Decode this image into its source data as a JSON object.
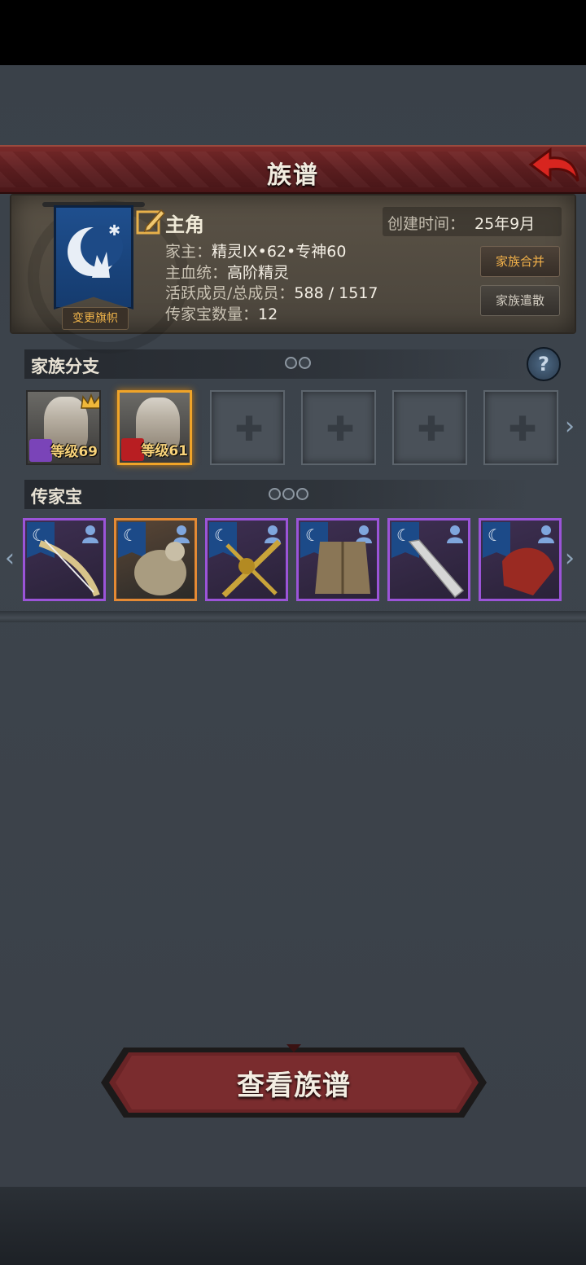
{
  "header": {
    "title": "族谱"
  },
  "profile": {
    "name": "主角",
    "created_label": "创建时间：",
    "created_value": "25年9月",
    "rows": [
      {
        "label": "家主：",
        "value": "精灵IX•62•专神60"
      },
      {
        "label": "主血统：",
        "value": "高阶精灵"
      },
      {
        "label": "活跃成员/总成员：",
        "value": "588 / 1517"
      },
      {
        "label": "传家宝数量：",
        "value": "12"
      }
    ],
    "change_banner_label": "变更旗帜",
    "merge_label": "家族合并",
    "disband_label": "家族遣散"
  },
  "branches": {
    "title": "家族分支",
    "heroes": [
      {
        "level": "等级69"
      },
      {
        "level": "等级61"
      }
    ]
  },
  "heirlooms": {
    "title": "传家宝"
  },
  "actions": {
    "view_label": "查看族谱"
  },
  "colors": {
    "accent_gold": "#f0a428",
    "purple_rarity": "#9b54d8",
    "orange_rarity": "#e48a34",
    "header_red": "#6a2224"
  },
  "icons": [
    "back-arrow-icon",
    "edit-icon",
    "help-icon",
    "chevron-right-icon",
    "chevron-left-icon",
    "crown-icon",
    "person-icon",
    "banner-moon-icon"
  ]
}
